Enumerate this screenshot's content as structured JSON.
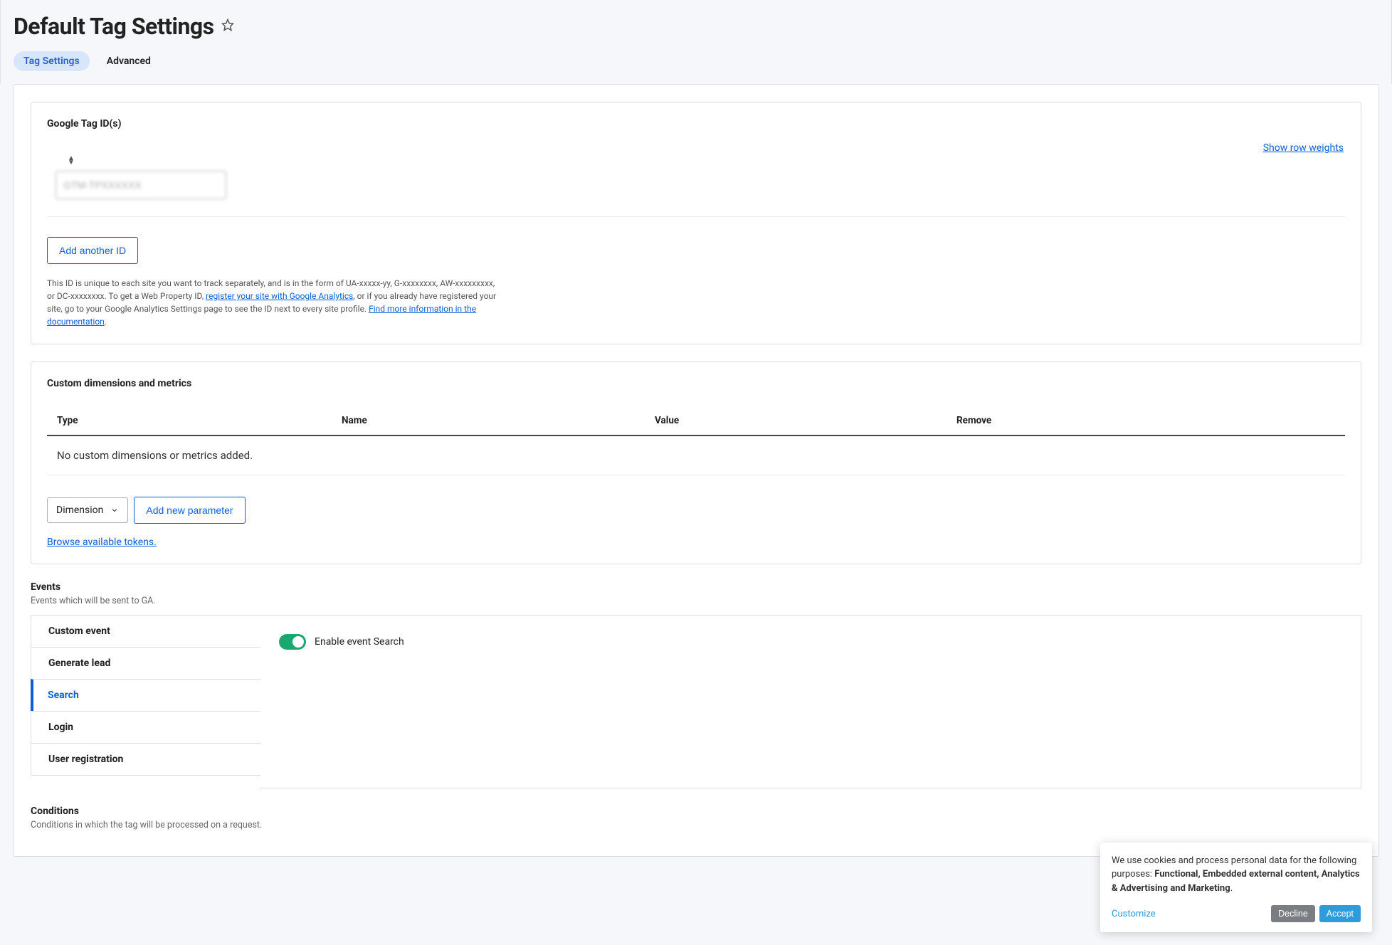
{
  "header": {
    "title": "Default Tag Settings"
  },
  "tabs": {
    "tag_settings": "Tag Settings",
    "advanced": "Advanced"
  },
  "tag_ids": {
    "title": "Google Tag ID(s)",
    "show_row_weights": "Show row weights",
    "input_value": "GTM-TPXXXXXX",
    "add_another": "Add another ID",
    "help_pre": "This ID is unique to each site you want to track separately, and is in the form of UA-xxxxx-yy, G-xxxxxxxx, AW-xxxxxxxxx, or DC-xxxxxxxx. To get a Web Property ID, ",
    "help_link1": "register your site with Google Analytics",
    "help_mid": ", or if you already have registered your site, go to your Google Analytics Settings page to see the ID next to every site profile. ",
    "help_link2": "Find more information in the documentation",
    "help_post": "."
  },
  "dimensions": {
    "title": "Custom dimensions and metrics",
    "cols": {
      "type": "Type",
      "name": "Name",
      "value": "Value",
      "remove": "Remove"
    },
    "empty": "No custom dimensions or metrics added.",
    "select_value": "Dimension",
    "add_param": "Add new parameter",
    "tokens_link": "Browse available tokens."
  },
  "events": {
    "heading": "Events",
    "sub": "Events which will be sent to GA.",
    "tabs": [
      "Custom event",
      "Generate lead",
      "Search",
      "Login",
      "User registration"
    ],
    "active_index": 2,
    "toggle_label": "Enable event Search",
    "toggle_on": true
  },
  "conditions": {
    "heading": "Conditions",
    "sub": "Conditions in which the tag will be processed on a request."
  },
  "cookie": {
    "text_pre": "We use cookies and process personal data for the following purposes: ",
    "text_bold": "Functional, Embedded external content, Analytics & Advertising and Marketing",
    "text_post": ".",
    "customize": "Customize",
    "decline": "Decline",
    "accept": "Accept"
  }
}
